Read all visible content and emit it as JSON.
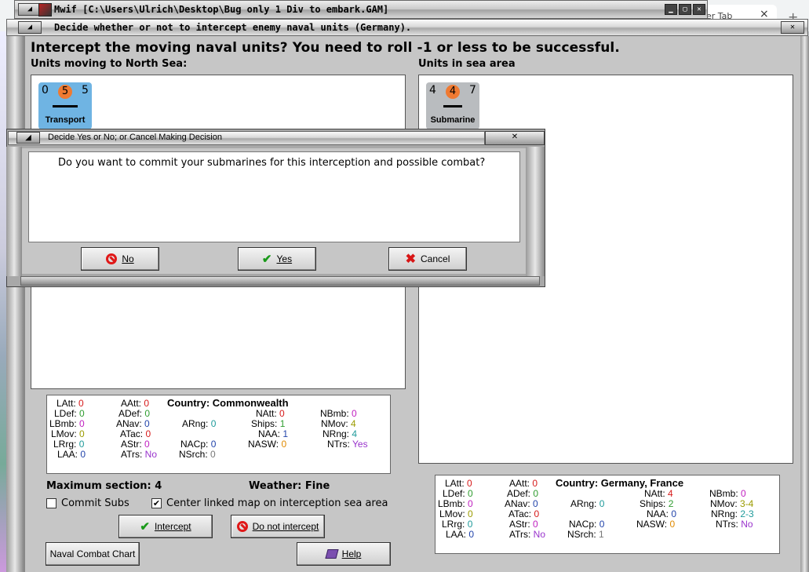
{
  "browser": {
    "tab_text": "er Tab",
    "close": "×",
    "plus": "+"
  },
  "window": {
    "title": "Mwif [C:\\Users\\Ulrich\\Desktop\\Bug only 1 Div to embark.GAM]",
    "dialog_title": "Decide whether or not to intercept enemy naval units (Germany)."
  },
  "main": {
    "question": "Intercept the moving naval units?  You need to roll -1 or less to be successful.",
    "moving_label": "Units moving to North Sea:",
    "sea_label": "Units in sea area",
    "moving_units": [
      {
        "left_num": "0",
        "badge": "5",
        "right_num": "5",
        "name": "Transport",
        "color": "#6fb4e3"
      }
    ],
    "sea_units": [
      {
        "left_num": "4",
        "badge": "4",
        "right_num": "7",
        "name": "Submarine",
        "color": "#b9bcbf"
      }
    ]
  },
  "stats_left": {
    "country_label": "Country:",
    "country": "Commonwealth",
    "LAtt": "0",
    "LDef": "0",
    "LBmb": "0",
    "LMov": "0",
    "LRrg": "0",
    "LAA": "0",
    "AAtt": "0",
    "ADef": "0",
    "ANav": "0",
    "ATac": "0",
    "AStr": "0",
    "ATrs": "No",
    "ARng": "0",
    "NACp": "0",
    "NSrch": "0",
    "NAtt": "0",
    "Ships": "1",
    "NAA": "1",
    "NASW": "0",
    "NBmb": "0",
    "NMov": "4",
    "NRng": "4",
    "NTrs": "Yes"
  },
  "stats_right": {
    "country_label": "Country:",
    "country": "Germany, France",
    "LAtt": "0",
    "LDef": "0",
    "LBmb": "0",
    "LMov": "0",
    "LRrg": "0",
    "LAA": "0",
    "AAtt": "0",
    "ADef": "0",
    "ANav": "0",
    "ATac": "0",
    "AStr": "0",
    "ATrs": "No",
    "ARng": "0",
    "NACp": "0",
    "NSrch": "1",
    "NAtt": "4",
    "Ships": "2",
    "NAA": "0",
    "NASW": "0",
    "NBmb": "0",
    "NMov": "3-4",
    "NRng": "2-3",
    "NTrs": "No"
  },
  "info": {
    "max_section": "Maximum section: 4",
    "weather": "Weather:  Fine",
    "commit_subs": "Commit Subs",
    "center_map": "Center linked map on interception sea area",
    "commit_subs_checked": false,
    "center_map_checked": true
  },
  "buttons": {
    "intercept": "Intercept",
    "do_not_intercept": "Do not intercept",
    "naval_combat_chart": "Naval Combat Chart",
    "help": "Help"
  },
  "modal": {
    "title": "Decide Yes or No; or Cancel Making Decision",
    "text": "Do you want to commit your submarines for this interception and possible combat?",
    "no": "No",
    "yes": "Yes",
    "cancel": "Cancel"
  },
  "icons": {
    "check_color": "#1a9a1a",
    "no_color": "#e01818"
  }
}
